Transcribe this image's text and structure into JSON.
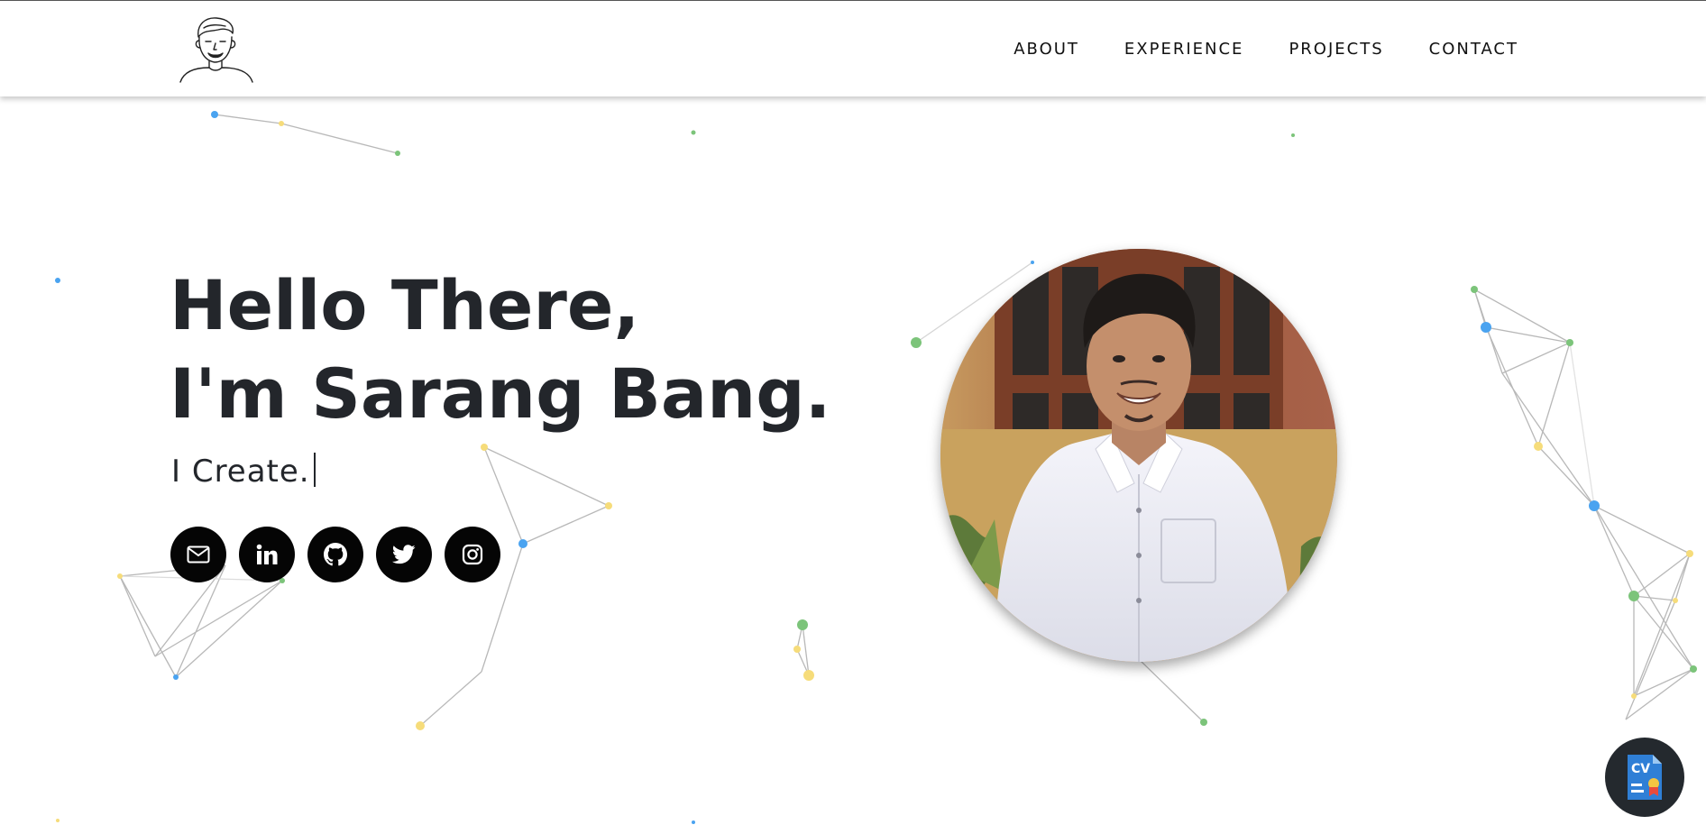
{
  "nav": {
    "links": [
      {
        "label": "ABOUT"
      },
      {
        "label": "EXPERIENCE"
      },
      {
        "label": "PROJECTS"
      },
      {
        "label": "CONTACT"
      }
    ]
  },
  "hero": {
    "greeting_line1": "Hello There,",
    "greeting_line2": "I'm Sarang Bang.",
    "typed_text": "I Create."
  },
  "socials": [
    {
      "icon": "mail-icon"
    },
    {
      "icon": "linkedin-icon"
    },
    {
      "icon": "github-icon"
    },
    {
      "icon": "twitter-icon"
    },
    {
      "icon": "instagram-icon"
    }
  ],
  "cv_button": {
    "label": "CV"
  },
  "colors": {
    "text": "#23262b",
    "social_bg": "#050505",
    "cv_bg": "#24292e",
    "node_blue": "#4aa3f0",
    "node_green": "#7cc47a",
    "node_yellow": "#f6dc7a"
  }
}
